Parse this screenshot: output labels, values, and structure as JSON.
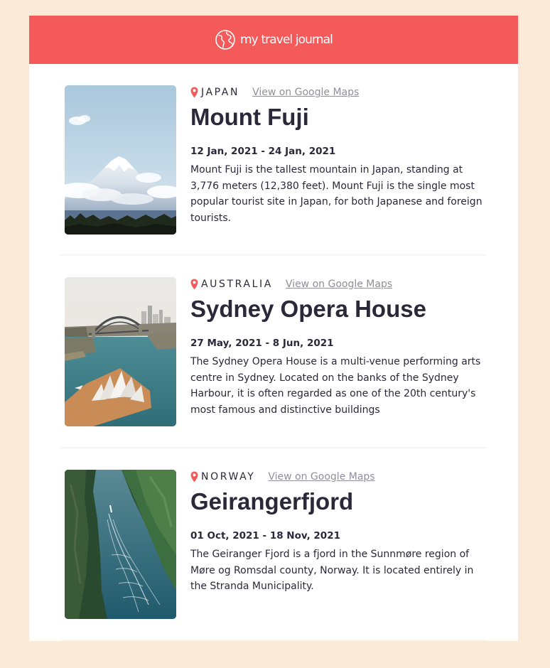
{
  "header": {
    "title": "my travel journal",
    "logo_icon": "globe-icon",
    "background_color": "#f55a5a"
  },
  "link_label": "View on Google Maps",
  "entries": [
    {
      "country": "JAPAN",
      "map_link_label": "View on Google Maps",
      "title": "Mount Fuji",
      "dates": "12 Jan, 2021 - 24 Jan, 2021",
      "description": "Mount Fuji is the tallest mountain in Japan, standing at 3,776 meters (12,380 feet). Mount Fuji is the single most popular tourist site in Japan, for both Japanese and foreign tourists."
    },
    {
      "country": "AUSTRALIA",
      "map_link_label": "View on Google Maps",
      "title": "Sydney Opera House",
      "dates": "27 May, 2021 - 8 Jun, 2021",
      "description": "The Sydney Opera House is a multi-venue performing arts centre in Sydney. Located on the banks of the Sydney Harbour, it is often regarded as one of the 20th century's most famous and distinctive buildings"
    },
    {
      "country": "NORWAY",
      "map_link_label": "View on Google Maps",
      "title": "Geirangerfjord",
      "dates": "01 Oct, 2021 - 18 Nov, 2021",
      "description": "The Geiranger Fjord is a fjord in the Sunnmøre region of Møre og Romsdal county, Norway. It is located entirely in the Stranda Municipality."
    }
  ],
  "colors": {
    "accent": "#f55a5a",
    "text": "#2b283a",
    "muted": "#918e9b",
    "page_background": "#fbead7"
  }
}
